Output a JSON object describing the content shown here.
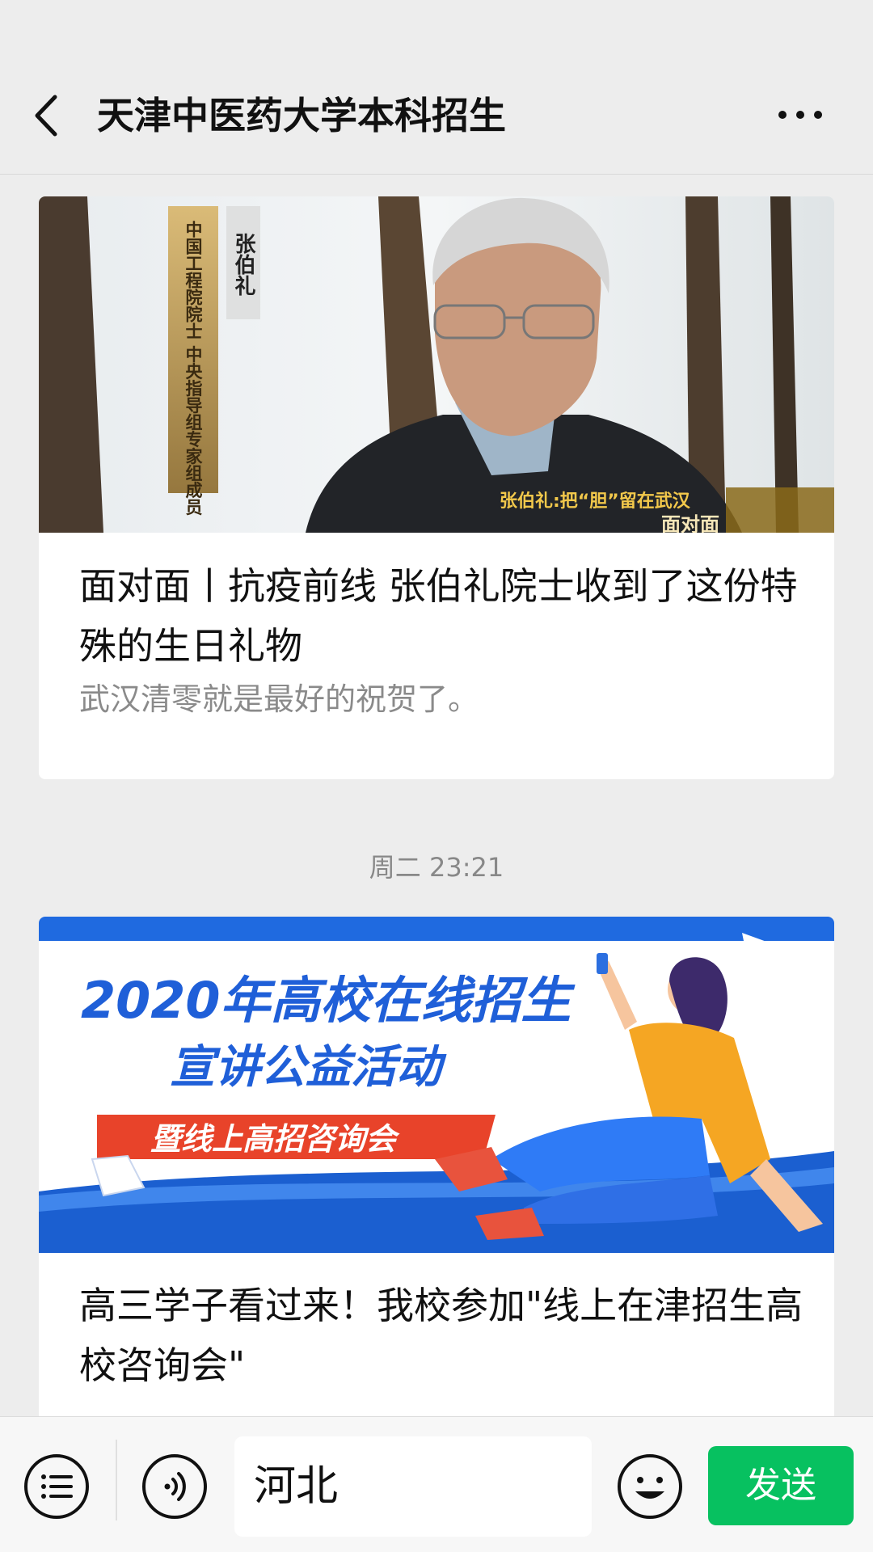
{
  "header": {
    "title": "天津中医药大学本科招生",
    "back_icon": "chevron-left-icon",
    "more_icon": "more-dots-icon"
  },
  "feed": {
    "articles": [
      {
        "cover_caption_name": "张伯礼",
        "cover_caption_role": "中国工程院院士 中央指导组专家组成员",
        "cover_subtitle": "张伯礼:把“胆”留在武汉",
        "cover_logo_text": "面对面",
        "title": "面对面丨抗疫前线 张伯礼院士收到了这份特殊的生日礼物",
        "desc": "武汉清零就是最好的祝贺了。"
      },
      {
        "cover_banner_line1": "2020年高校在线招生",
        "cover_banner_line2": "宣讲公益活动",
        "cover_banner_line3": "暨线上高招咨询会",
        "title": "高三学子看过来！我校参加\"线上在津招生高校咨询会\""
      }
    ],
    "timestamp": "周二 23:21"
  },
  "bottom_bar": {
    "menu_icon": "list-menu-icon",
    "voice_icon": "voice-icon",
    "input_value": "河北",
    "emoji_icon": "emoji-icon",
    "send_label": "发送",
    "send_color": "#07c160"
  }
}
